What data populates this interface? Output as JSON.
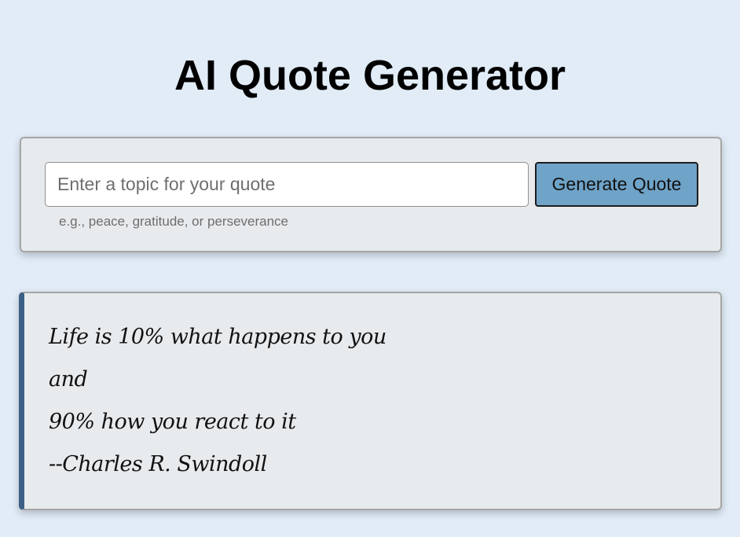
{
  "header": {
    "title": "AI Quote Generator"
  },
  "form": {
    "input_value": "",
    "input_placeholder": "Enter a topic for your quote",
    "hint": "e.g., peace, gratitude, or perseverance",
    "button_label": "Generate Quote"
  },
  "quote": {
    "lines": [
      "Life is 10% what happens to you",
      "and",
      "90% how you react to it",
      "--Charles R. Swindoll"
    ]
  },
  "colors": {
    "background": "#e1ecf7",
    "card": "#e8ebee",
    "button": "#6fa3c8",
    "quote_accent": "#3c5f84"
  }
}
